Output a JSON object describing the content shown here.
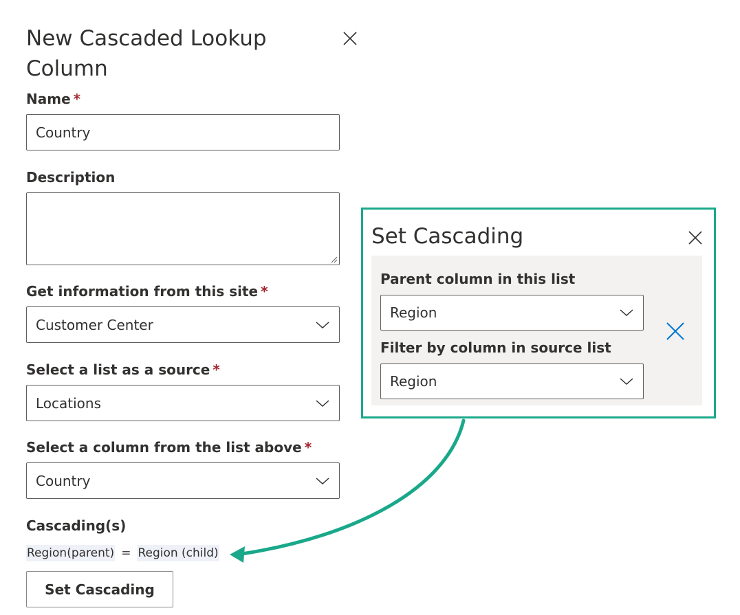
{
  "panel": {
    "title": "New Cascaded Lookup Column",
    "close_icon": "close-icon"
  },
  "fields": {
    "name": {
      "label": "Name",
      "required": "*",
      "value": "Country"
    },
    "description": {
      "label": "Description",
      "value": ""
    },
    "site": {
      "label": "Get information from this site",
      "required": "*",
      "value": "Customer Center"
    },
    "source_list": {
      "label": "Select a list as a source",
      "required": "*",
      "value": "Locations"
    },
    "column": {
      "label": "Select a column from the list above",
      "required": "*",
      "value": "Country"
    }
  },
  "cascading": {
    "label": "Cascading(s)",
    "parent": "Region(parent)",
    "equals": "=",
    "child": "Region (child)",
    "button_label": "Set Cascading"
  },
  "set_cascading_dialog": {
    "title": "Set Cascading",
    "parent_label": "Parent column in this list",
    "parent_value": "Region",
    "filter_label": "Filter by column in source list",
    "filter_value": "Region"
  },
  "colors": {
    "accent_green": "#1aa88a",
    "remove_blue": "#0078d4",
    "required_red": "#a4262c"
  }
}
